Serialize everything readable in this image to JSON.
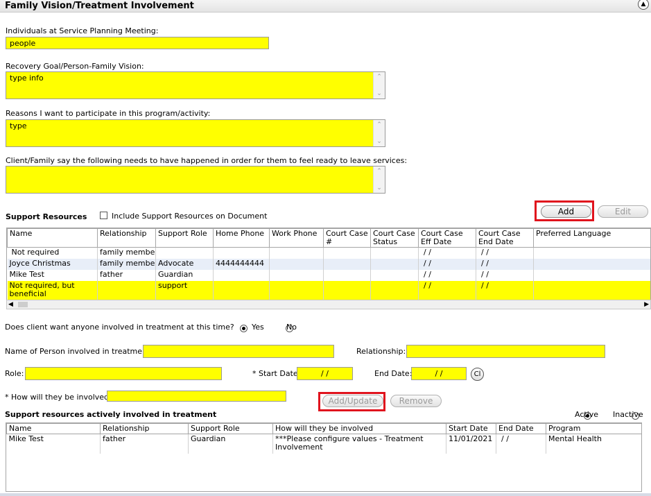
{
  "header": {
    "title": "Family Vision/Treatment Involvement",
    "collapse_icon": "collapse-up-icon"
  },
  "fields": {
    "individuals_label": "Individuals at Service Planning Meeting:",
    "individuals_value": "people",
    "recovery_label": "Recovery Goal/Person-Family Vision:",
    "recovery_value": "type info",
    "reasons_label": "Reasons I want to participate in this program/activity:",
    "reasons_value": "type",
    "client_family_label": "Client/Family say the following needs to have happened in order for them to feel ready to leave services:",
    "client_family_value": ""
  },
  "support_resources": {
    "title": "Support Resources",
    "include_checkbox_label": "Include Support Resources on Document",
    "include_checked": false,
    "add_label": "Add",
    "edit_label": "Edit",
    "columns": [
      "Name",
      "Relationship",
      "Support Role",
      "Home Phone",
      "Work Phone",
      "Court Case #",
      "Court Case Status",
      "Court Case Eff Date",
      "Court Case End Date",
      "Preferred Language"
    ],
    "rows": [
      [
        "Not required",
        "family member",
        "",
        "",
        "",
        "",
        "",
        "/ /",
        "/ /",
        ""
      ],
      [
        "Joyce Christmas",
        "family member",
        "Advocate",
        "4444444444",
        "",
        "",
        "",
        "/ /",
        "/ /",
        ""
      ],
      [
        "Mike Test",
        "father",
        "Guardian",
        "",
        "",
        "",
        "",
        "/ /",
        "/ /",
        ""
      ],
      [
        "Not required, but beneficial",
        "",
        "support",
        "",
        "",
        "",
        "",
        "/ /",
        "/ /",
        ""
      ]
    ]
  },
  "involvement": {
    "question": "Does client want anyone involved in treatment at this time?",
    "yes_label": "Yes",
    "no_label": "No",
    "selected": "Yes",
    "name_label": "Name of Person involved in treatment:",
    "name_value": "",
    "relationship_label": "Relationship:",
    "relationship_value": "",
    "role_label": "Role:",
    "role_value": "",
    "start_date_label": "* Start Date:",
    "start_date_value": "/ /",
    "end_date_label": "End Date:",
    "end_date_value": "/ /",
    "clear_label": "Cl",
    "how_label": "* How will they be involved:",
    "how_value": "",
    "add_update_label": "Add/Update",
    "remove_label": "Remove"
  },
  "active_resources": {
    "title": "Support resources actively involved in treatment",
    "active_label": "Active",
    "inactive_label": "Inactive",
    "filter_selected": "Active",
    "columns": [
      "Name",
      "Relationship",
      "Support Role",
      "How will they be involved",
      "Start Date",
      "End Date",
      "Program"
    ],
    "rows": [
      [
        "Mike Test",
        "father",
        "Guardian",
        "***Please configure values - Treatment Involvement",
        "11/01/2021",
        "/ /",
        "Mental Health"
      ]
    ]
  },
  "colors": {
    "highlight": "#ffff00",
    "annotation_box": "#e0131d"
  }
}
